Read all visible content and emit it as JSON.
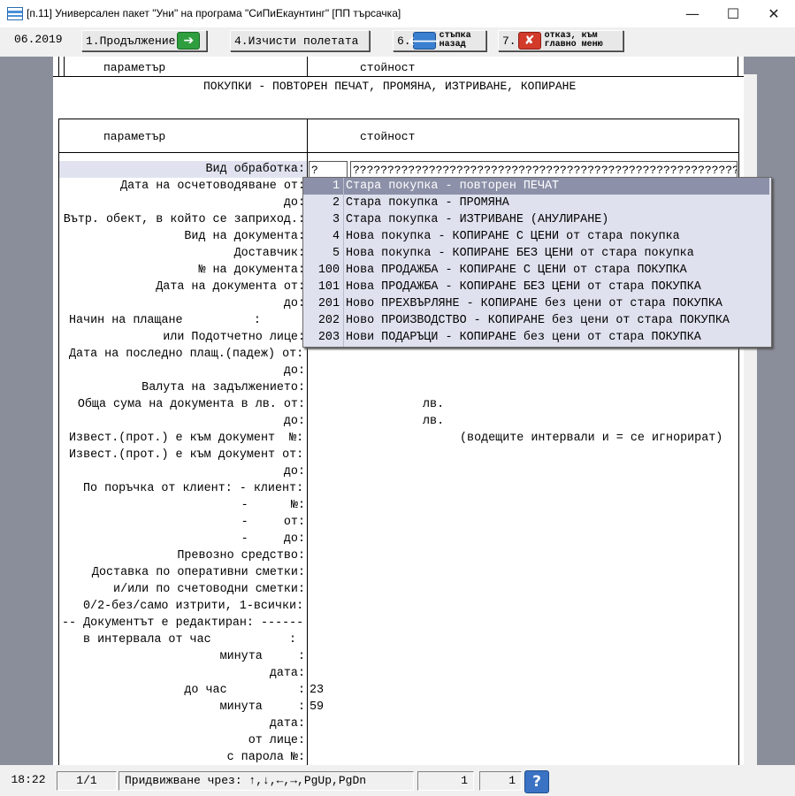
{
  "window": {
    "title": "[п.11] Универсален пакет \"Уни\" на програма \"СиПиЕкаунтинг\" [ПП търсачка]",
    "minimize": "—",
    "maximize": "☐",
    "close": "✕"
  },
  "toolbar": {
    "period": "06.2019",
    "btn_continue": "1.Продължение",
    "btn_clear": "4.Изчисти полетата",
    "btn_back_num": "6.",
    "btn_back_l1": "стъпка",
    "btn_back_l2": "назад",
    "btn_cancel_num": "7.",
    "btn_cancel_l1": "отказ, към",
    "btn_cancel_l2": "главно меню"
  },
  "table_header": {
    "col1": "параметър",
    "col2": "стойност"
  },
  "form": {
    "title": "ПОКУПКИ - ПОВТОРЕН ПЕЧАТ, ПРОМЯНА, ИЗТРИВАНЕ, КОПИРАНЕ",
    "col1": "параметър",
    "col2": "стойност",
    "type_code": "?",
    "type_text": "????????????????????????????????????????????????????????",
    "rows": [
      "Вид обработка:",
      "Дата на осчетоводяване от:",
      "до:",
      "Вътр. обект, в който се заприход.:",
      "Вид на документа:",
      "Доставчик:",
      "№ на документа:",
      "Дата на документа от:",
      "до:",
      "Начин на плащане          :",
      "или Подотчетно лице:",
      "Дата на последно плащ.(падеж) от:",
      "до:",
      "Валута на задължението:",
      "Обща сума на документа в лв. от:",
      "до:",
      "Извест.(прот.) е към документ  №:",
      "Извест.(прот.) е към документ от:",
      "до:",
      "По поръчка от клиент: - клиент:",
      "-      №:",
      "-     от:",
      "-     до:",
      "Превозно средство:",
      "Доставка по оперативни сметки:",
      "и/или по счетоводни сметки:",
      "0/2-без/само изтрити, 1-всички:",
      "-- Документът е редактиран: ------",
      "в интервала от час           :",
      "минута     :",
      "дата:",
      "до час          :",
      "минута     :",
      "дата:",
      "от лице:",
      "с парола №:"
    ],
    "amount_from_unit": "лв.",
    "amount_to_unit": "лв.",
    "note_ref": "(водещите интервали и = се игнорират)",
    "hour_to": "23",
    "minute_to": "59"
  },
  "dropdown": [
    {
      "num": "1",
      "text": "Стара покупка - повторен ПЕЧАТ"
    },
    {
      "num": "2",
      "text": "Стара покупка - ПРОМЯНА"
    },
    {
      "num": "3",
      "text": "Стара покупка - ИЗТРИВАНЕ (АНУЛИРАНЕ)"
    },
    {
      "num": "4",
      "text": "Нова покупка - КОПИРАНЕ С ЦЕНИ от стара покупка"
    },
    {
      "num": "5",
      "text": "Нова покупка - КОПИРАНЕ БЕЗ ЦЕНИ от стара покупка"
    },
    {
      "num": "100",
      "text": "Нова ПРОДАЖБА - КОПИРАНЕ С ЦЕНИ от стара ПОКУПКА"
    },
    {
      "num": "101",
      "text": "Нова ПРОДАЖБА - КОПИРАНЕ БЕЗ ЦЕНИ от стара ПОКУПКА"
    },
    {
      "num": "201",
      "text": "Ново ПРЕХВЪРЛЯНЕ - КОПИРАНЕ без цени от стара ПОКУПКА"
    },
    {
      "num": "202",
      "text": "Ново ПРОИЗВОДСТВО - КОПИРАНЕ без цени от стара ПОКУПКА"
    },
    {
      "num": "203",
      "text": "Нови ПОДАРЪЦИ - КОПИРАНЕ без цени от стара ПОКУПКА"
    }
  ],
  "statusbar": {
    "time": "18:22",
    "page": "1/1",
    "hint": "Придвижване чрез: ↑,↓,←,→,PgUp,PgDn",
    "val1": "1",
    "val2": "1",
    "help": "?"
  }
}
